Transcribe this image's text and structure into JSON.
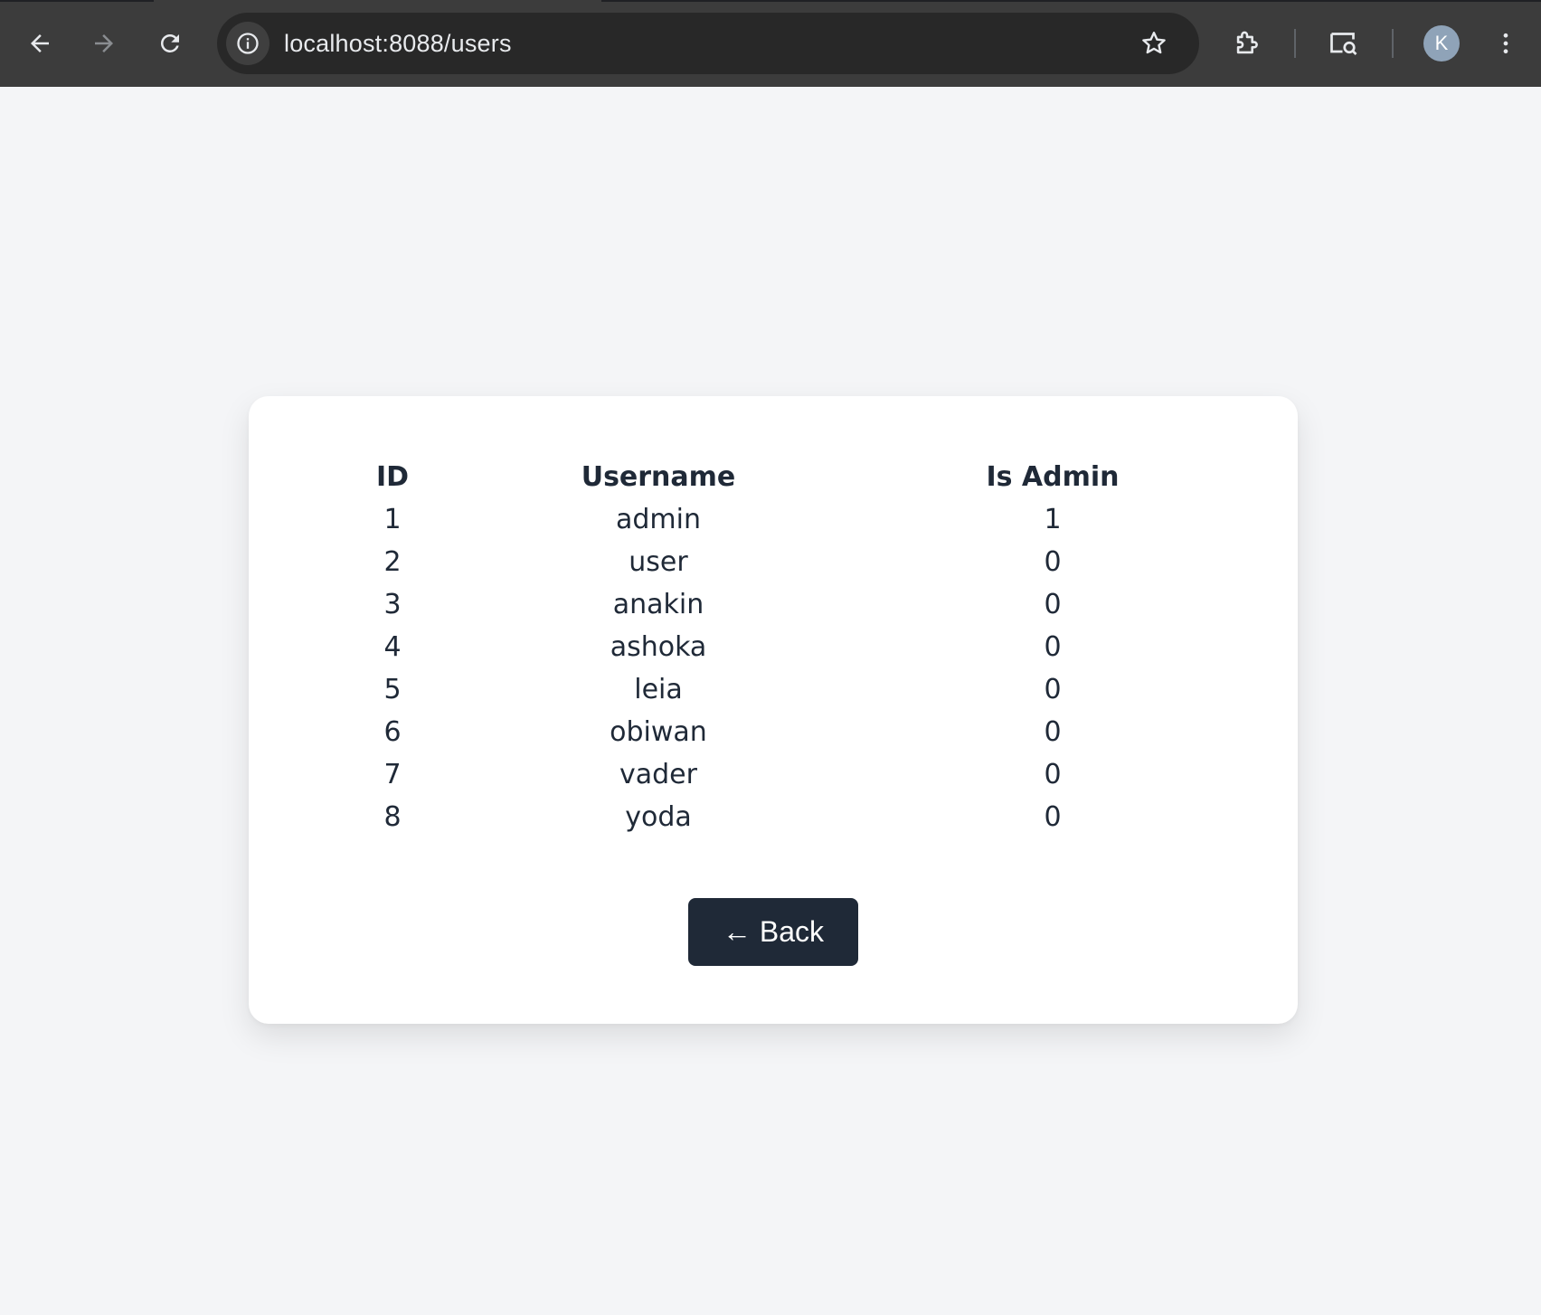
{
  "browser": {
    "url": "localhost:8088/users",
    "profile_initial": "K",
    "icons": [
      "back-arrow-icon",
      "forward-arrow-icon",
      "reload-icon",
      "info-icon",
      "star-icon",
      "extensions-icon",
      "tab-search-icon",
      "more-menu-icon"
    ]
  },
  "table": {
    "headers": [
      "ID",
      "Username",
      "Is Admin"
    ],
    "rows": [
      {
        "id": "1",
        "username": "admin",
        "is_admin": "1"
      },
      {
        "id": "2",
        "username": "user",
        "is_admin": "0"
      },
      {
        "id": "3",
        "username": "anakin",
        "is_admin": "0"
      },
      {
        "id": "4",
        "username": "ashoka",
        "is_admin": "0"
      },
      {
        "id": "5",
        "username": "leia",
        "is_admin": "0"
      },
      {
        "id": "6",
        "username": "obiwan",
        "is_admin": "0"
      },
      {
        "id": "7",
        "username": "vader",
        "is_admin": "0"
      },
      {
        "id": "8",
        "username": "yoda",
        "is_admin": "0"
      }
    ]
  },
  "actions": {
    "back_label": "← Back"
  },
  "colors": {
    "page_bg": "#f4f5f7",
    "card_bg": "#ffffff",
    "button_bg": "#1f2937",
    "text": "#1f2937",
    "browser_chrome": "#3c3c3c"
  }
}
